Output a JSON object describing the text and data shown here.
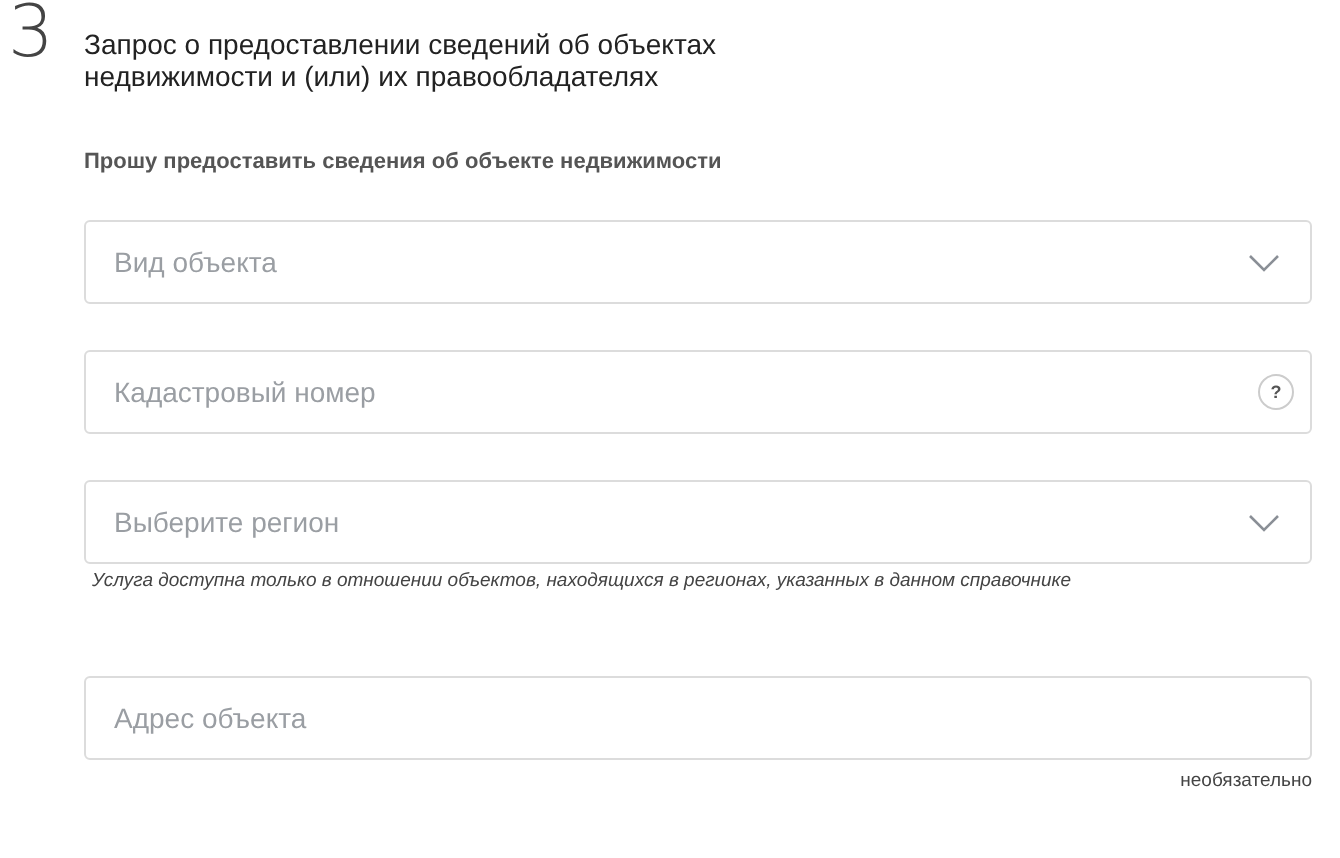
{
  "step": {
    "number": "3",
    "title": "Запрос о предоставлении сведений об объектах недвижимости и (или) их правообладателях"
  },
  "subtitle": "Прошу предоставить сведения об объекте недвижимости",
  "fields": [
    {
      "kind": "select",
      "placeholder": "Вид объекта"
    },
    {
      "kind": "help",
      "placeholder": "Кадастровый номер",
      "help": "?"
    },
    {
      "kind": "select",
      "placeholder": "Выберите регион",
      "hint": "Услуга доступна только в отношении объектов, находящихся в регионах, указанных в данном справочнике"
    },
    {
      "kind": "text",
      "placeholder": "Адрес объекта",
      "note": "необязательно"
    }
  ]
}
